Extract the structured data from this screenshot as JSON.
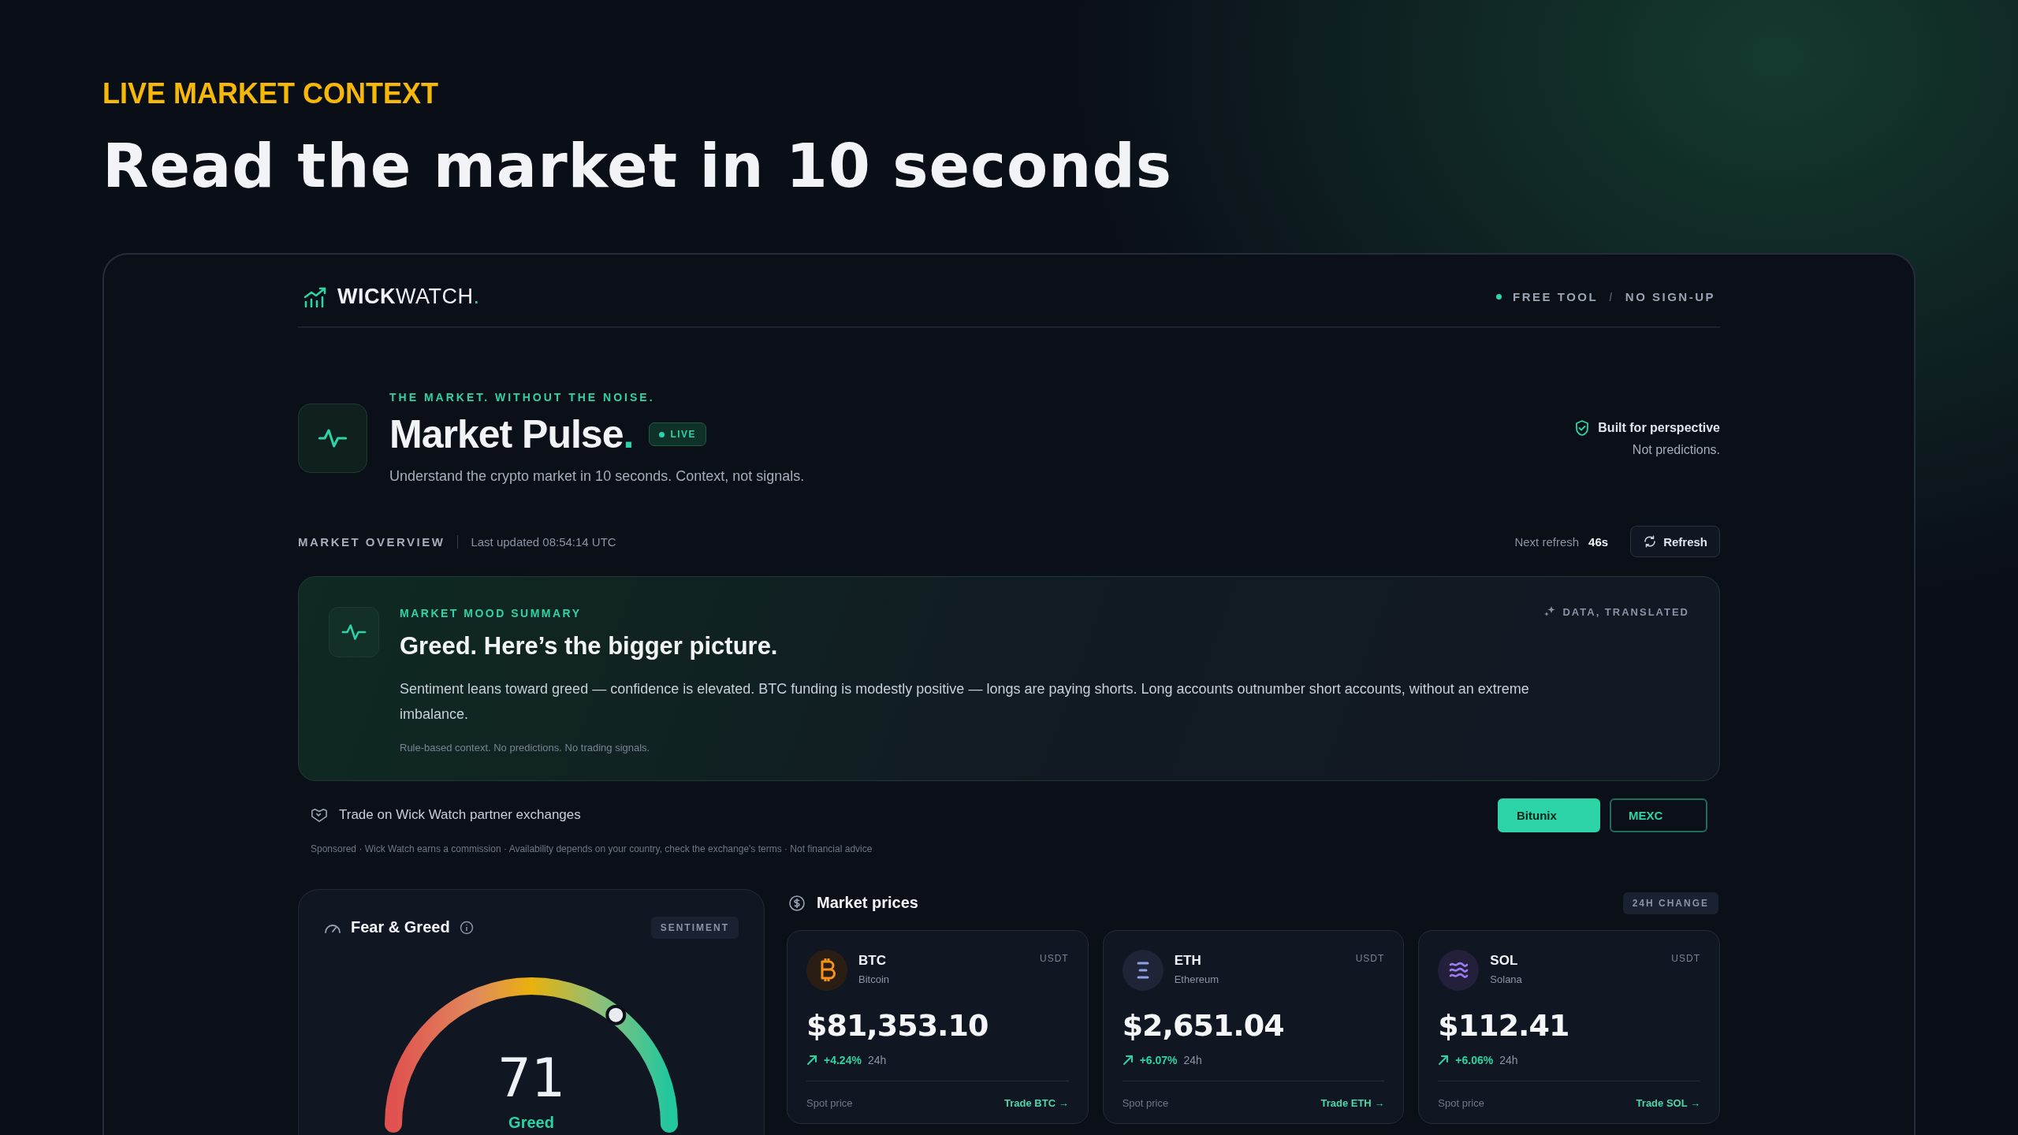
{
  "hero": {
    "eyebrow": "LIVE MARKET CONTEXT",
    "title": "Read the market in 10 seconds"
  },
  "app": {
    "logo": {
      "text": "**WICK**WATCH",
      "mark": "."
    },
    "header_tags": [
      "FREE TOOL",
      "NO SIGN-UP"
    ],
    "header_separator": "/",
    "pulse": {
      "eyebrow": "THE MARKET. WITHOUT THE NOISE.",
      "title": "Market Pulse",
      "title_mark": ".",
      "badge": "LIVE",
      "subtitle": "Understand the crypto market in 10 seconds. Context, not signals.",
      "note_title": "Built for perspective",
      "note_text": "Not predictions."
    },
    "overview": {
      "label": "MARKET OVERVIEW",
      "updated": "Last updated 08:54:14 UTC",
      "next_refresh_label": "Next refresh",
      "next_refresh_value": "46s",
      "refresh_button": "Refresh"
    },
    "mood": {
      "eyebrow": "MARKET MOOD SUMMARY",
      "tag": "DATA, TRANSLATED",
      "title": "Greed. Here’s the bigger picture.",
      "body": "Sentiment leans toward greed — confidence is elevated. BTC funding is modestly positive — longs are paying shorts. Long accounts outnumber short accounts, without an extreme imbalance.",
      "footnote": "Rule-based context. No predictions. No trading signals."
    },
    "partners": {
      "text": "Trade on Wick Watch partner exchanges",
      "buttons": [
        {
          "label": "Bitunix",
          "kind": "filled"
        },
        {
          "label": "MEXC",
          "kind": "outline"
        }
      ],
      "disclaimer": "Sponsored · Wick Watch earns a commission · Availability depends on your country, check the exchange's terms · Not financial advice"
    },
    "fear_greed": {
      "title": "Fear & Greed",
      "tag": "SENTIMENT",
      "value": "71",
      "label": "Greed"
    },
    "prices": {
      "title": "Market prices",
      "tag": "24H CHANGE",
      "coins": [
        {
          "kind": "btc",
          "symbol": "BTC",
          "name": "Bitcoin",
          "quote": "USDT",
          "price": "$81,353.10",
          "change": "+4.24%",
          "period": "24h",
          "footer": "Spot price",
          "link": "Trade BTC →"
        },
        {
          "kind": "eth",
          "symbol": "ETH",
          "name": "Ethereum",
          "quote": "USDT",
          "price": "$2,651.04",
          "change": "+6.07%",
          "period": "24h",
          "footer": "Spot price",
          "link": "Trade ETH →"
        },
        {
          "kind": "sol",
          "symbol": "SOL",
          "name": "Solana",
          "quote": "USDT",
          "price": "$112.41",
          "change": "+6.06%",
          "period": "24h",
          "footer": "Spot price",
          "link": "Trade SOL →"
        }
      ]
    }
  }
}
